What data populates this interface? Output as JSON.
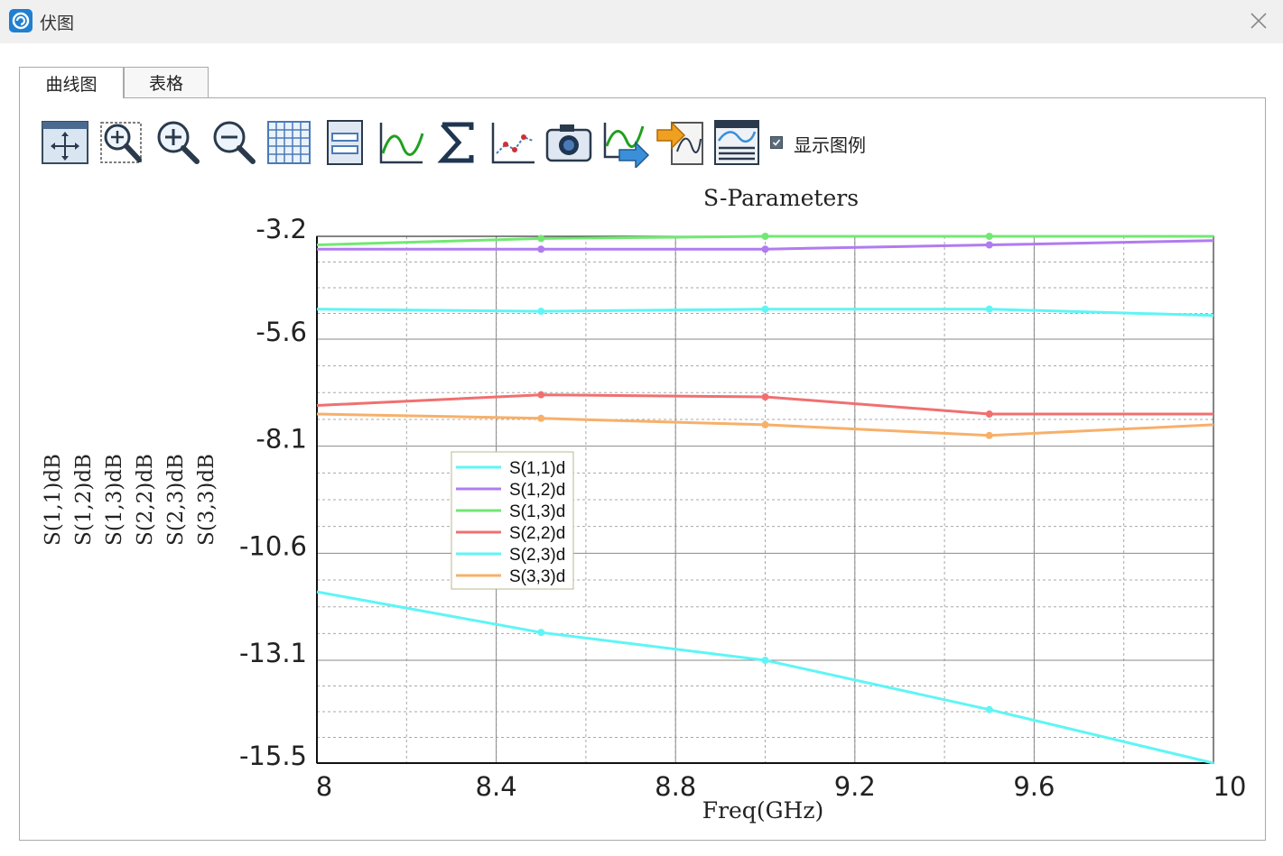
{
  "window": {
    "title": "伏图"
  },
  "tabs": [
    {
      "label": "曲线图",
      "active": true
    },
    {
      "label": "表格",
      "active": false
    }
  ],
  "toolbar": {
    "tools": [
      "pan-fit-icon",
      "zoom-region-icon",
      "zoom-in-icon",
      "zoom-out-icon",
      "grid-icon",
      "save-icon",
      "curve-icon",
      "sigma-icon",
      "marker-curve-icon",
      "camera-icon",
      "export-curve-icon",
      "import-data-icon",
      "data-table-icon"
    ],
    "show_legend_label": "显示图例",
    "show_legend_checked": true
  },
  "chart_data": {
    "type": "line",
    "title": "S-Parameters",
    "xlabel": "Freq(GHz)",
    "ylabels": [
      "S(1,1)dB",
      "S(1,2)dB",
      "S(1,3)dB",
      "S(2,2)dB",
      "S(2,3)dB",
      "S(3,3)dB"
    ],
    "xlim": [
      8,
      10
    ],
    "ylim": [
      -15.5,
      -3.2
    ],
    "xticks": [
      "8",
      "8.4",
      "8.8",
      "9.2",
      "9.6",
      "10"
    ],
    "yticks": [
      "-3.2",
      "-5.6",
      "-8.1",
      "-10.6",
      "-13.1",
      "-15.5"
    ],
    "x": [
      8,
      8.5,
      9,
      9.5,
      10
    ],
    "grid": true,
    "legend_position": "center-left",
    "series": [
      {
        "name": "S(1,1)d",
        "color": "#5ff5f5",
        "values": [
          -11.5,
          -12.45,
          -13.1,
          -14.25,
          -15.5
        ]
      },
      {
        "name": "S(1,2)d",
        "color": "#b07cf0",
        "values": [
          -3.5,
          -3.5,
          -3.5,
          -3.4,
          -3.3
        ]
      },
      {
        "name": "S(1,3)d",
        "color": "#72e872",
        "values": [
          -3.4,
          -3.25,
          -3.2,
          -3.2,
          -3.2
        ]
      },
      {
        "name": "S(2,2)d",
        "color": "#f07070",
        "values": [
          -7.15,
          -6.9,
          -6.95,
          -7.35,
          -7.35
        ]
      },
      {
        "name": "S(2,3)d",
        "color": "#5ff5f5",
        "values": [
          -4.9,
          -4.95,
          -4.9,
          -4.9,
          -5.05
        ]
      },
      {
        "name": "S(3,3)d",
        "color": "#f7b06a",
        "values": [
          -7.35,
          -7.45,
          -7.6,
          -7.85,
          -7.6
        ]
      }
    ]
  }
}
